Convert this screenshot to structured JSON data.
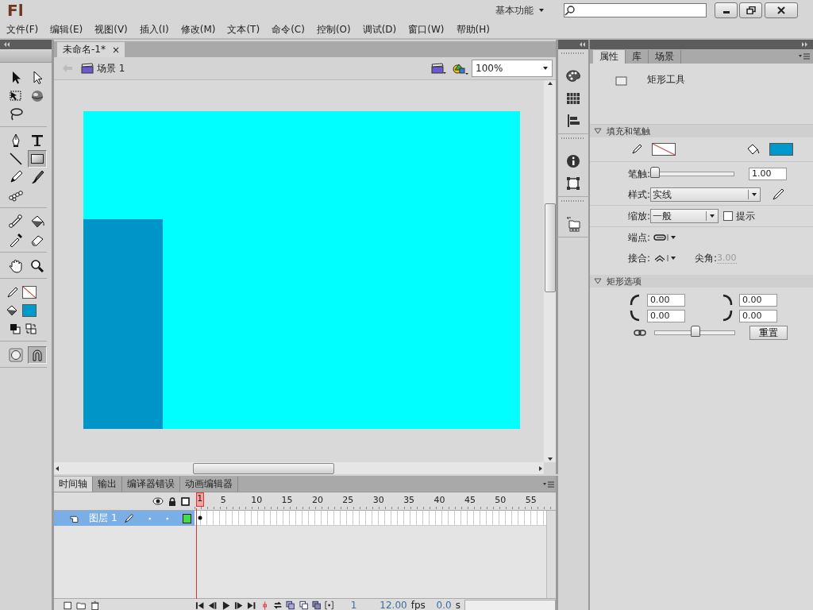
{
  "title_bar": {
    "logo": "Fl",
    "workspace": "基本功能"
  },
  "menu": [
    "文件(F)",
    "编辑(E)",
    "视图(V)",
    "插入(I)",
    "修改(M)",
    "文本(T)",
    "命令(C)",
    "控制(O)",
    "调试(D)",
    "窗口(W)",
    "帮助(H)"
  ],
  "toolbox": {
    "groups": [
      {
        "kind": "tools",
        "tools": [
          {
            "kind": "selection",
            "selected": false
          },
          {
            "kind": "subselection",
            "selected": false
          },
          {
            "kind": "transform",
            "selected": false
          },
          {
            "kind": "rotation",
            "selected": false
          },
          {
            "kind": "lasso",
            "selected": false
          }
        ]
      },
      {
        "kind": "tools",
        "tools": [
          {
            "kind": "pen",
            "selected": false
          },
          {
            "kind": "text",
            "selected": false
          },
          {
            "kind": "line",
            "selected": false
          },
          {
            "kind": "rectangle",
            "selected": true
          },
          {
            "kind": "pencil",
            "selected": false
          },
          {
            "kind": "brush",
            "selected": false
          },
          {
            "kind": "deco",
            "selected": false
          }
        ]
      },
      {
        "kind": "tools",
        "tools": [
          {
            "kind": "bone",
            "selected": false
          },
          {
            "kind": "bucket",
            "selected": false
          },
          {
            "kind": "eyedropper",
            "selected": false
          },
          {
            "kind": "eraser",
            "selected": false
          }
        ]
      },
      {
        "kind": "tools",
        "tools": [
          {
            "kind": "hand",
            "selected": false
          },
          {
            "kind": "zoom",
            "selected": false
          }
        ]
      },
      {
        "kind": "colors",
        "swatches": [
          {
            "kind": "stroke",
            "no_color": true
          },
          {
            "kind": "fill",
            "no_color": false,
            "color": "#0099cc"
          }
        ]
      },
      {
        "kind": "tools",
        "tools": [
          {
            "kind": "drawing",
            "selected": false
          },
          {
            "kind": "snap",
            "selected": true
          }
        ]
      }
    ]
  },
  "document": {
    "tab": {
      "label": "未命名-1*",
      "selected": true
    },
    "close": "×",
    "scene": "场景 1",
    "zoom": "100%"
  },
  "timeline": {
    "tabs": [
      {
        "label": "时间轴",
        "selected": true
      },
      {
        "label": "输出",
        "selected": false
      },
      {
        "label": "编译器错误",
        "selected": false
      },
      {
        "label": "动画编辑器",
        "selected": false
      }
    ],
    "frame_numbers": [
      {
        "label": "1",
        "selected": true
      },
      {
        "label": "5",
        "selected": false
      },
      {
        "label": "10",
        "selected": false
      },
      {
        "label": "15",
        "selected": false
      },
      {
        "label": "20",
        "selected": false
      },
      {
        "label": "25",
        "selected": false
      },
      {
        "label": "30",
        "selected": false
      },
      {
        "label": "35",
        "selected": false
      },
      {
        "label": "40",
        "selected": false
      },
      {
        "label": "45",
        "selected": false
      },
      {
        "label": "50",
        "selected": false
      },
      {
        "label": "55",
        "selected": false
      }
    ],
    "layers": [
      {
        "name": "图层 1",
        "selected": true,
        "color": "#44dd44"
      }
    ],
    "status": {
      "frame": "1",
      "fps": "12.00",
      "fps_unit": "fps",
      "time": "0.0",
      "time_unit": "s"
    }
  },
  "properties": {
    "tabs": [
      {
        "label": "属性",
        "selected": true
      },
      {
        "label": "库",
        "selected": false
      },
      {
        "label": "场景",
        "selected": false
      }
    ],
    "tool_name": "矩形工具",
    "fill_stroke": {
      "title": "填充和笔触",
      "expanded": true,
      "swatches": [
        {
          "kind": "stroke",
          "no_color": true
        },
        {
          "kind": "fill",
          "no_color": false,
          "color": "#0099cc"
        }
      ],
      "stroke": {
        "label": "笔触:",
        "level": 0,
        "value": "1.00"
      },
      "style": {
        "label": "样式:",
        "value": "实线"
      },
      "scale": {
        "label": "缩放:",
        "value": "一般",
        "hint": "提示",
        "checked": false
      },
      "cap": {
        "label": "端点:"
      },
      "join": {
        "label": "接合:"
      },
      "miter": {
        "label": "尖角:",
        "value": "3.00",
        "disabled": true
      }
    },
    "rect_options": {
      "title": "矩形选项",
      "expanded": true,
      "corners": [
        "0.00",
        "0.00",
        "0.00",
        "0.00"
      ],
      "level": 0.5,
      "reset": "重置"
    }
  }
}
